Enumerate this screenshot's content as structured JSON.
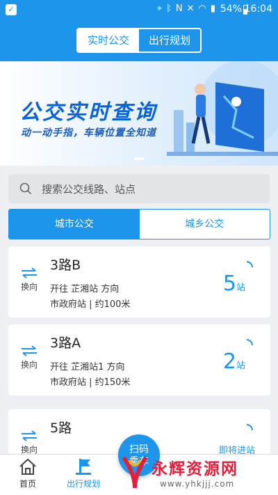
{
  "status_bar": {
    "battery": "54%",
    "time": "16:04"
  },
  "header": {
    "toggle": [
      {
        "label": "实时公交",
        "active": true
      },
      {
        "label": "出行规划",
        "active": false
      }
    ]
  },
  "banner": {
    "title": "公交实时查询",
    "subtitle": "动一动手指，车辆位置全知道"
  },
  "search": {
    "placeholder": "搜索公交线路、站点"
  },
  "tabs": [
    {
      "label": "城市公交",
      "active": true
    },
    {
      "label": "城乡公交",
      "active": false
    }
  ],
  "routes": [
    {
      "swap_label": "换向",
      "name": "3路B",
      "direction": "开往 芷湘站 方向",
      "stop": "市政府站 | 约100米",
      "eta_num": "5",
      "eta_unit": "站"
    },
    {
      "swap_label": "换向",
      "name": "3路A",
      "direction": "开往 芷湘站1 方向",
      "stop": "市政府站 | 约150米",
      "eta_num": "2",
      "eta_unit": "站"
    },
    {
      "swap_label": "换向",
      "name": "5路",
      "status": "即将进站"
    }
  ],
  "fab": {
    "label_line1": "扫码",
    "label_line2": "乘车"
  },
  "bottom_nav": [
    {
      "label": "首页",
      "icon": "home-icon",
      "active": false
    },
    {
      "label": "出行规划",
      "icon": "bus-stop-flag-icon",
      "active": true
    }
  ],
  "watermark": {
    "text": "永辉资源网",
    "url": "www.yhkjjj.com"
  },
  "colors": {
    "primary": "#1c95ea",
    "watermark_red": "#e0203c"
  }
}
